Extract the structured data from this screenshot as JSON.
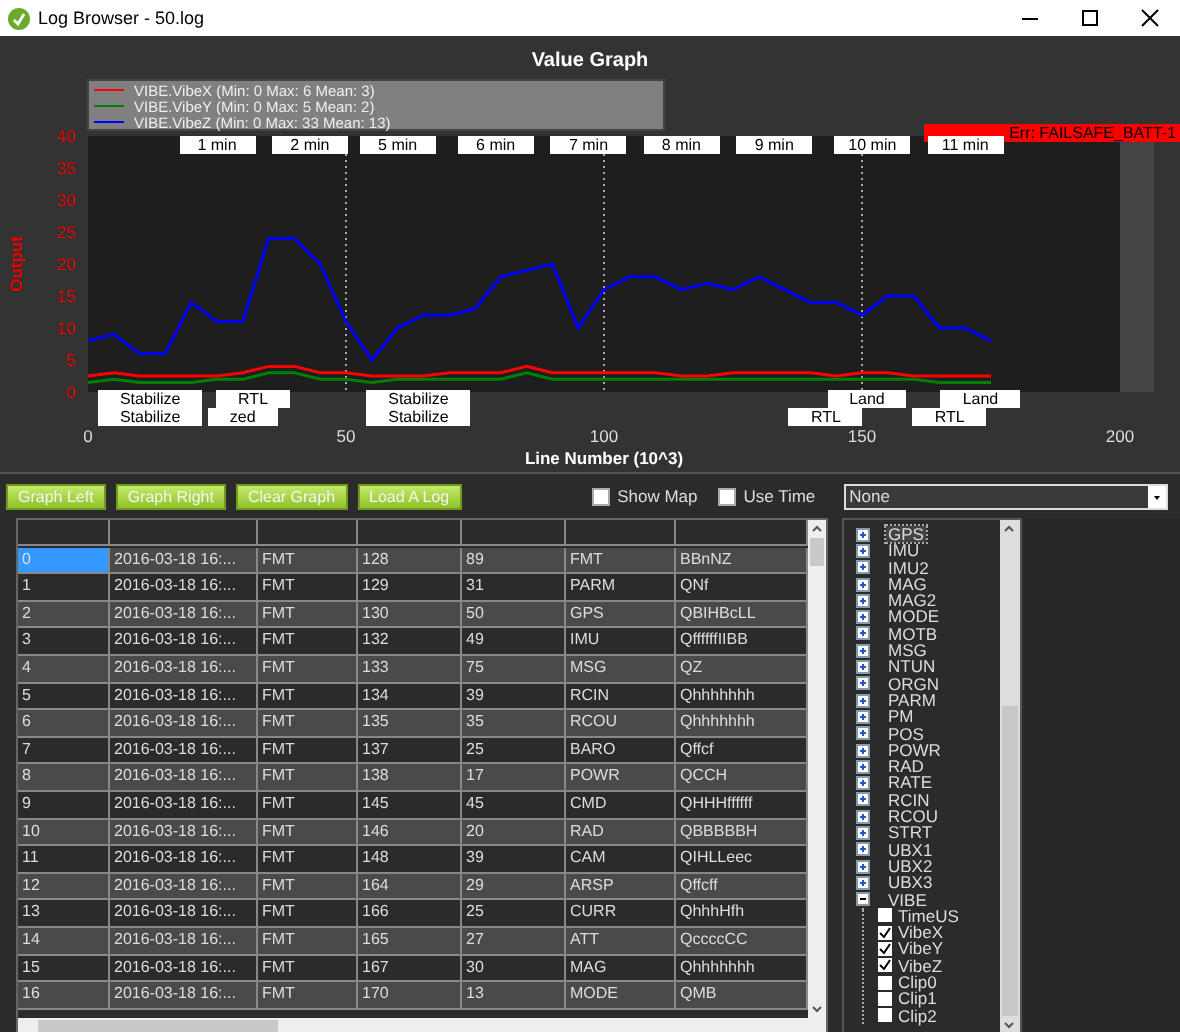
{
  "window": {
    "title": "Log Browser - 50.log"
  },
  "graph": {
    "chart_data": {
      "type": "line",
      "title": "Value Graph",
      "xlabel": "Line Number (10^3)",
      "ylabel": "Output",
      "x": [
        0,
        5,
        10,
        15,
        20,
        25,
        30,
        35,
        40,
        45,
        50,
        55,
        60,
        65,
        70,
        75,
        80,
        85,
        90,
        95,
        100,
        105,
        110,
        115,
        120,
        125,
        130,
        135,
        140,
        145,
        150,
        155,
        160,
        165,
        170,
        175
      ],
      "series": [
        {
          "name": "VIBE.VibeX (Min: 0 Max: 6 Mean: 3)",
          "color": "#ff0000",
          "values": [
            2.5,
            3,
            2.5,
            2.5,
            2.5,
            2.5,
            3,
            4,
            4,
            3,
            3,
            2.5,
            2.5,
            2.5,
            3,
            3,
            3,
            4,
            3,
            3,
            3,
            3,
            3,
            2.5,
            2.5,
            3,
            3,
            3,
            3,
            2.5,
            3,
            3,
            2.5,
            2.5,
            2.5,
            2.5
          ]
        },
        {
          "name": "VIBE.VibeY (Min: 0 Max: 5 Mean: 2)",
          "color": "#008000",
          "values": [
            1.5,
            2,
            1.5,
            1.5,
            1.5,
            2,
            2,
            3,
            3,
            2,
            2,
            1.5,
            2,
            2,
            2,
            2,
            2,
            3,
            2,
            2,
            2,
            2,
            2,
            2,
            2,
            2,
            2,
            2,
            2,
            2,
            2,
            2,
            2,
            1.5,
            1.5,
            1.5
          ]
        },
        {
          "name": "VIBE.VibeZ (Min: 0 Max: 33 Mean: 13)",
          "color": "#0000ff",
          "values": [
            8,
            9,
            6,
            6,
            14,
            11,
            11,
            24,
            24,
            20,
            11,
            5,
            10,
            12,
            12,
            13,
            18,
            19,
            20,
            10,
            16,
            18,
            18,
            16,
            17,
            16,
            18,
            16,
            14,
            14,
            12,
            15,
            15,
            10,
            10,
            8
          ]
        }
      ],
      "xlim": [
        0,
        200
      ],
      "ylim": [
        0,
        40
      ],
      "xticks": [
        0,
        50,
        100,
        150,
        200
      ],
      "yticks": [
        0,
        5,
        10,
        15,
        20,
        25,
        30,
        35,
        40
      ],
      "grid": true,
      "legend": "upper left"
    },
    "time_markers": [
      "1 min",
      "2 min",
      "5 min",
      "6 min",
      "7 min",
      "8 min",
      "9 min",
      "10 min",
      "11 min"
    ],
    "error_message": "Err: FAILSAFE_BATT-1",
    "mode_markers": [
      "Stabilize",
      "RTL",
      "Stabilize",
      "Land",
      "Land",
      "Stabilize",
      "zed",
      "Stabilize",
      "RTL",
      "RTL"
    ]
  },
  "toolbar": {
    "buttons": [
      "Graph Left",
      "Graph Right",
      "Clear Graph",
      "Load A Log"
    ],
    "checkboxes": [
      {
        "label": "Show Map",
        "checked": false
      },
      {
        "label": "Use Time",
        "checked": false
      }
    ],
    "dropdown": {
      "value": "None"
    }
  },
  "table": {
    "rows": [
      {
        "selected": true,
        "cells": [
          "0",
          "2016-03-18 16:...",
          "FMT",
          "128",
          "89",
          "FMT",
          "BBnNZ"
        ]
      },
      {
        "selected": false,
        "cells": [
          "1",
          "2016-03-18 16:...",
          "FMT",
          "129",
          "31",
          "PARM",
          "QNf"
        ]
      },
      {
        "selected": false,
        "cells": [
          "2",
          "2016-03-18 16:...",
          "FMT",
          "130",
          "50",
          "GPS",
          "QBIHBcLL"
        ]
      },
      {
        "selected": false,
        "cells": [
          "3",
          "2016-03-18 16:...",
          "FMT",
          "132",
          "49",
          "IMU",
          "QffffffIIBB"
        ]
      },
      {
        "selected": false,
        "cells": [
          "4",
          "2016-03-18 16:...",
          "FMT",
          "133",
          "75",
          "MSG",
          "QZ"
        ]
      },
      {
        "selected": false,
        "cells": [
          "5",
          "2016-03-18 16:...",
          "FMT",
          "134",
          "39",
          "RCIN",
          "Qhhhhhhh"
        ]
      },
      {
        "selected": false,
        "cells": [
          "6",
          "2016-03-18 16:...",
          "FMT",
          "135",
          "35",
          "RCOU",
          "Qhhhhhhh"
        ]
      },
      {
        "selected": false,
        "cells": [
          "7",
          "2016-03-18 16:...",
          "FMT",
          "137",
          "25",
          "BARO",
          "Qffcf"
        ]
      },
      {
        "selected": false,
        "cells": [
          "8",
          "2016-03-18 16:...",
          "FMT",
          "138",
          "17",
          "POWR",
          "QCCH"
        ]
      },
      {
        "selected": false,
        "cells": [
          "9",
          "2016-03-18 16:...",
          "FMT",
          "145",
          "45",
          "CMD",
          "QHHHffffff"
        ]
      },
      {
        "selected": false,
        "cells": [
          "10",
          "2016-03-18 16:...",
          "FMT",
          "146",
          "20",
          "RAD",
          "QBBBBBH"
        ]
      },
      {
        "selected": false,
        "cells": [
          "11",
          "2016-03-18 16:...",
          "FMT",
          "148",
          "39",
          "CAM",
          "QIHLLeec"
        ]
      },
      {
        "selected": false,
        "cells": [
          "12",
          "2016-03-18 16:...",
          "FMT",
          "164",
          "29",
          "ARSP",
          "Qffcff"
        ]
      },
      {
        "selected": false,
        "cells": [
          "13",
          "2016-03-18 16:...",
          "FMT",
          "166",
          "25",
          "CURR",
          "QhhhHfh"
        ]
      },
      {
        "selected": false,
        "cells": [
          "14",
          "2016-03-18 16:...",
          "FMT",
          "165",
          "27",
          "ATT",
          "QccccCC"
        ]
      },
      {
        "selected": false,
        "cells": [
          "15",
          "2016-03-18 16:...",
          "FMT",
          "167",
          "30",
          "MAG",
          "Qhhhhhhh"
        ]
      },
      {
        "selected": false,
        "cells": [
          "16",
          "2016-03-18 16:...",
          "FMT",
          "170",
          "13",
          "MODE",
          "QMB"
        ]
      }
    ]
  },
  "tree": {
    "items": [
      {
        "label": "GPS",
        "selected": true,
        "expanded": false
      },
      {
        "label": "IMU",
        "selected": false,
        "expanded": false
      },
      {
        "label": "IMU2",
        "selected": false,
        "expanded": false
      },
      {
        "label": "MAG",
        "selected": false,
        "expanded": false
      },
      {
        "label": "MAG2",
        "selected": false,
        "expanded": false
      },
      {
        "label": "MODE",
        "selected": false,
        "expanded": false
      },
      {
        "label": "MOTB",
        "selected": false,
        "expanded": false
      },
      {
        "label": "MSG",
        "selected": false,
        "expanded": false
      },
      {
        "label": "NTUN",
        "selected": false,
        "expanded": false
      },
      {
        "label": "ORGN",
        "selected": false,
        "expanded": false
      },
      {
        "label": "PARM",
        "selected": false,
        "expanded": false
      },
      {
        "label": "PM",
        "selected": false,
        "expanded": false
      },
      {
        "label": "POS",
        "selected": false,
        "expanded": false
      },
      {
        "label": "POWR",
        "selected": false,
        "expanded": false
      },
      {
        "label": "RAD",
        "selected": false,
        "expanded": false
      },
      {
        "label": "RATE",
        "selected": false,
        "expanded": false
      },
      {
        "label": "RCIN",
        "selected": false,
        "expanded": false
      },
      {
        "label": "RCOU",
        "selected": false,
        "expanded": false
      },
      {
        "label": "STRT",
        "selected": false,
        "expanded": false
      },
      {
        "label": "UBX1",
        "selected": false,
        "expanded": false
      },
      {
        "label": "UBX2",
        "selected": false,
        "expanded": false
      },
      {
        "label": "UBX3",
        "selected": false,
        "expanded": false
      },
      {
        "label": "VIBE",
        "selected": false,
        "expanded": true,
        "children": [
          {
            "label": "TimeUS",
            "checked": false
          },
          {
            "label": "VibeX",
            "checked": true
          },
          {
            "label": "VibeY",
            "checked": true
          },
          {
            "label": "VibeZ",
            "checked": true
          },
          {
            "label": "Clip0",
            "checked": false
          },
          {
            "label": "Clip1",
            "checked": false
          },
          {
            "label": "Clip2",
            "checked": false
          }
        ]
      }
    ]
  }
}
